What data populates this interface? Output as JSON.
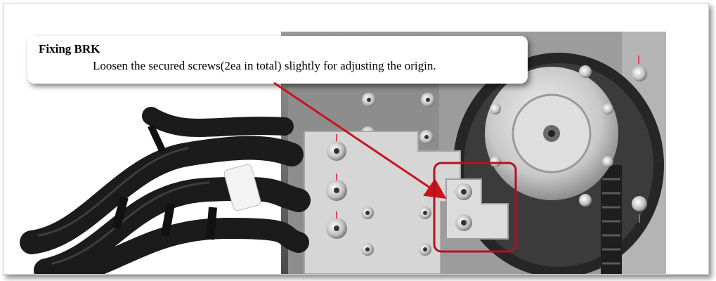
{
  "callout": {
    "title": "Fixing BRK",
    "body": "Loosen the secured screws(2ea in total) slightly for adjusting the origin."
  },
  "colors": {
    "highlight": "#b3121e",
    "arrow": "#c8141e",
    "plate": "#d2d2d2",
    "cable": "#1c1c1c"
  },
  "icons": [
    "pulley",
    "timing-belt",
    "screw",
    "cable-tie",
    "cable-label"
  ]
}
